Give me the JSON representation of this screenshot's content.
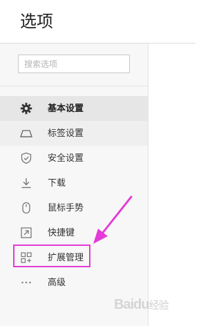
{
  "header": {
    "title": "选项"
  },
  "search": {
    "placeholder": "搜索选项"
  },
  "sidebar": {
    "items": [
      {
        "label": "基本设置",
        "icon": "gear-icon"
      },
      {
        "label": "标签设置",
        "icon": "tab-icon"
      },
      {
        "label": "安全设置",
        "icon": "shield-icon"
      },
      {
        "label": "下载",
        "icon": "download-icon"
      },
      {
        "label": "鼠标手势",
        "icon": "mouse-icon"
      },
      {
        "label": "快捷键",
        "icon": "shortcut-icon"
      },
      {
        "label": "扩展管理",
        "icon": "extensions-icon"
      },
      {
        "label": "高级",
        "icon": "more-icon"
      }
    ]
  },
  "annotation": {
    "color": "#e53ad8"
  },
  "watermark": {
    "text": "Baidu",
    "text2": "经验"
  }
}
